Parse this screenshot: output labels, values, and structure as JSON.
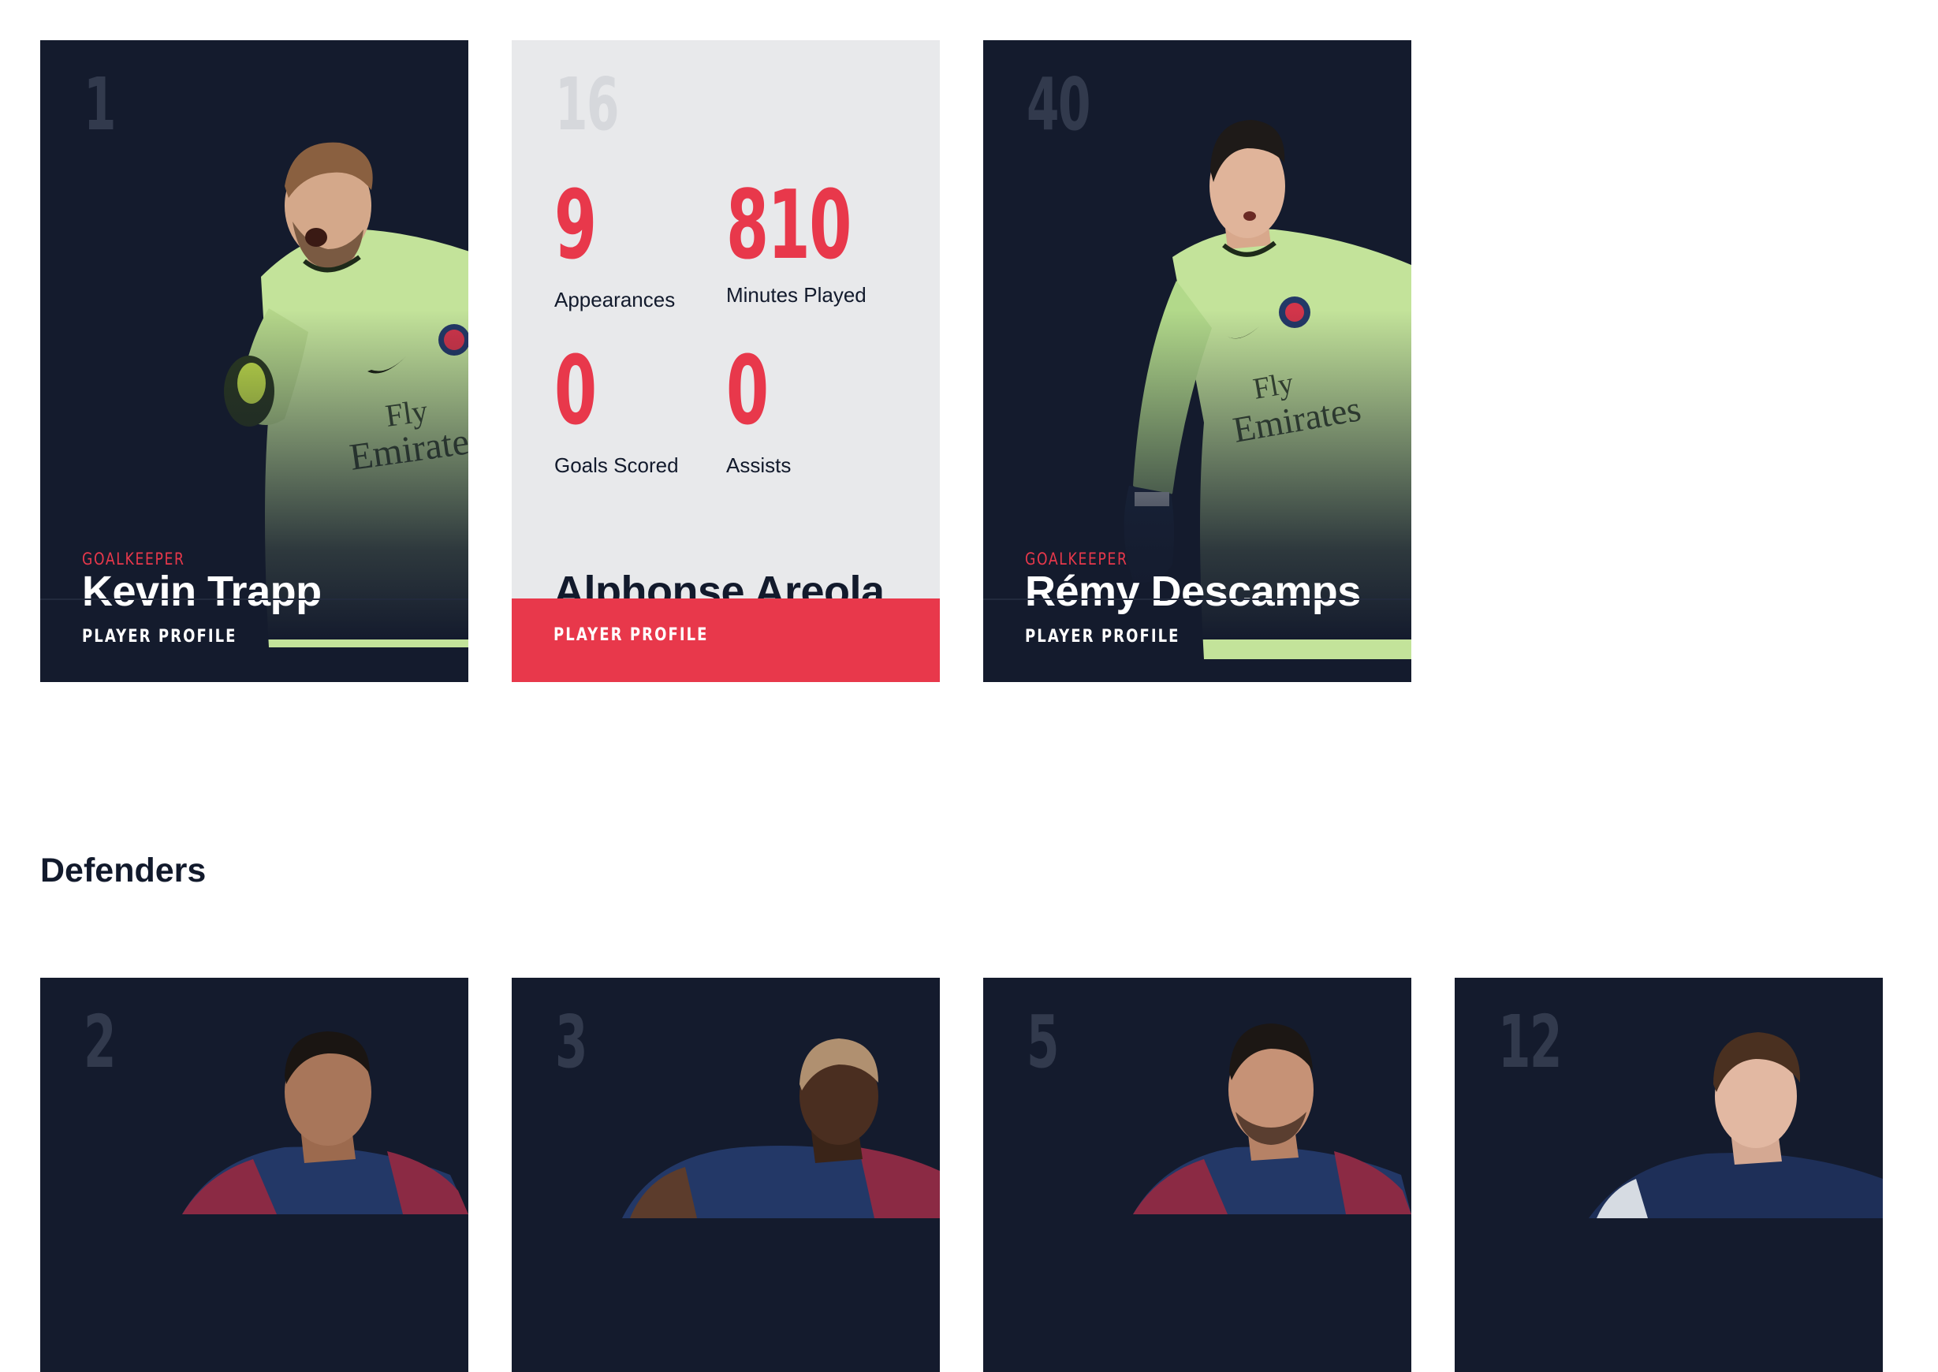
{
  "goalkeepers": [
    {
      "number": "1",
      "position": "GOALKEEPER",
      "name": "Kevin Trapp",
      "cta": "PLAYER PROFILE"
    },
    {
      "number": "16",
      "name": "Alphonse Areola",
      "cta": "PLAYER PROFILE",
      "stats": {
        "appearances_value": "9",
        "appearances_label": "Appearances",
        "minutes_value": "810",
        "minutes_label": "Minutes Played",
        "goals_value": "0",
        "goals_label": "Goals Scored",
        "assists_value": "0",
        "assists_label": "Assists"
      }
    },
    {
      "number": "40",
      "position": "GOALKEEPER",
      "name": "Rémy Descamps",
      "cta": "PLAYER PROFILE"
    }
  ],
  "defenders_section": {
    "title": "Defenders"
  },
  "defenders": [
    {
      "number": "2"
    },
    {
      "number": "3"
    },
    {
      "number": "5"
    },
    {
      "number": "12"
    }
  ],
  "colors": {
    "card_bg": "#141b2d",
    "accent": "#e8384b",
    "stats_bg": "#e8e9eb",
    "number_muted": "#323a4d",
    "keeper_kit": "#c3e39a",
    "home_kit": "#233867"
  }
}
